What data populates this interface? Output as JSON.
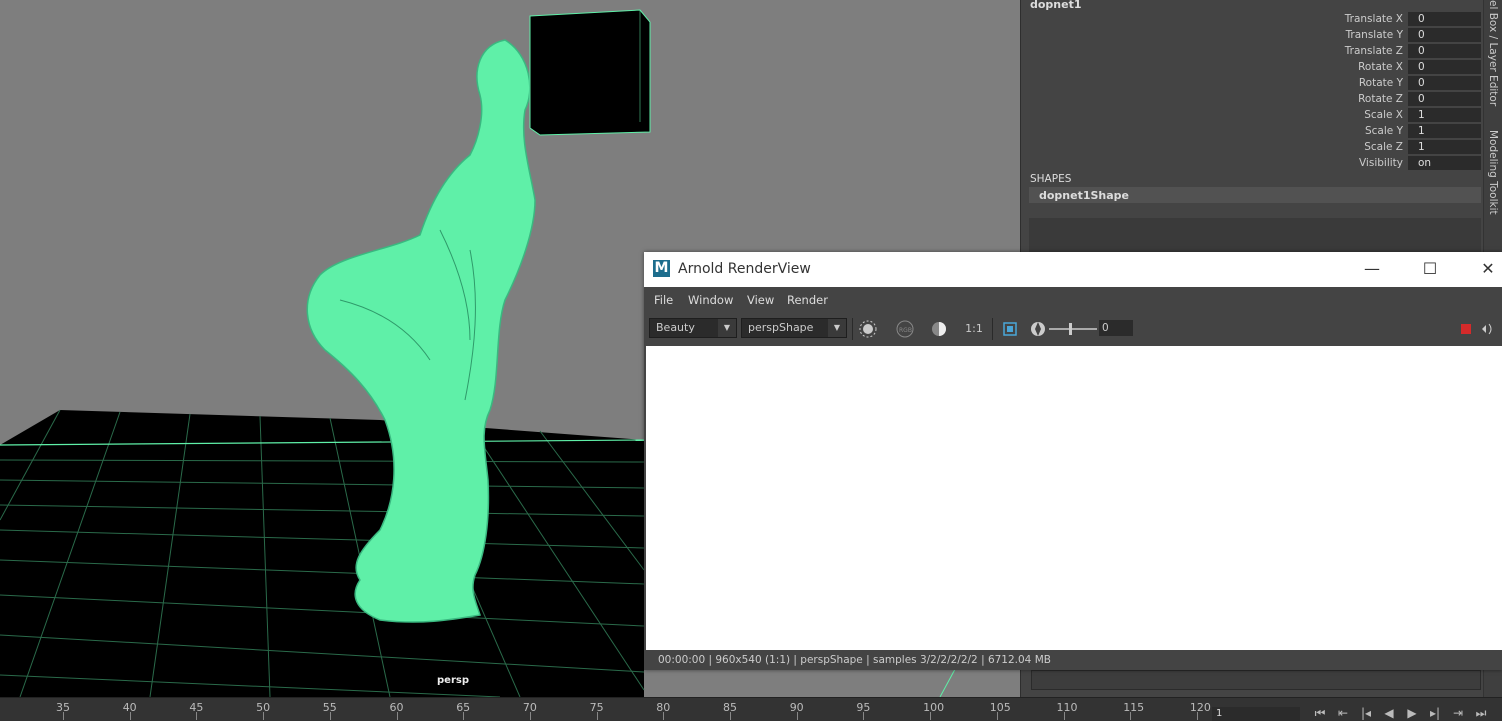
{
  "viewport": {
    "camera_label": "persp",
    "background_color": "#7e7e7e",
    "wire_color": "#5ff0a8"
  },
  "channel_box": {
    "object_name": "dopnet1",
    "attributes": [
      {
        "label": "Translate X",
        "value": "0"
      },
      {
        "label": "Translate Y",
        "value": "0"
      },
      {
        "label": "Translate Z",
        "value": "0"
      },
      {
        "label": "Rotate X",
        "value": "0"
      },
      {
        "label": "Rotate Y",
        "value": "0"
      },
      {
        "label": "Rotate Z",
        "value": "0"
      },
      {
        "label": "Scale X",
        "value": "1"
      },
      {
        "label": "Scale Y",
        "value": "1"
      },
      {
        "label": "Scale Z",
        "value": "1"
      },
      {
        "label": "Visibility",
        "value": "on"
      }
    ],
    "shapes_heading": "SHAPES",
    "shape_name": "dopnet1Shape",
    "side_tabs": [
      "el Box / Layer Editor",
      "Modeling Toolkit"
    ]
  },
  "render_view": {
    "title": "Arnold RenderView",
    "menu": [
      "File",
      "Window",
      "View",
      "Render"
    ],
    "aov_select": "Beauty",
    "camera_select": "perspShape",
    "ratio_label": "1:1",
    "exposure_value": "0",
    "status": "00:00:00 | 960x540 (1:1) | perspShape  | samples 3/2/2/2/2/2 | 6712.04 MB",
    "window_buttons": {
      "minimize": "—",
      "maximize": "☐",
      "close": "✕"
    },
    "stop_color": "#d42a2a"
  },
  "timeline": {
    "ticks": [
      "35",
      "40",
      "45",
      "50",
      "55",
      "60",
      "65",
      "70",
      "75",
      "80",
      "85",
      "90",
      "95",
      "100",
      "105",
      "110",
      "115",
      "120"
    ],
    "current_frame": "1",
    "playback_icons": [
      "go-to-start-icon",
      "step-back-key-icon",
      "prev-key-icon",
      "play-backward-icon",
      "play-forward-icon",
      "next-key-icon",
      "step-forward-icon",
      "go-to-end-icon"
    ]
  }
}
